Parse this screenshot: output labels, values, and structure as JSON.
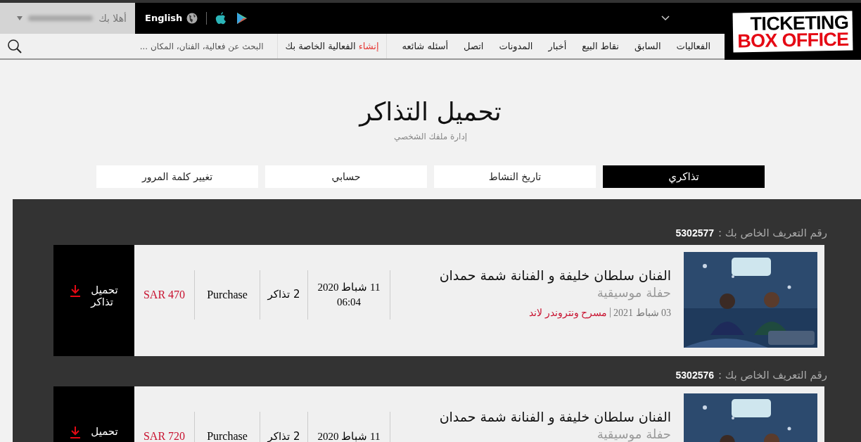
{
  "header": {
    "language": "English",
    "greeting": "أهلا بك"
  },
  "nav": [
    "الفعاليات",
    "السابق",
    "نقاط البيع",
    "أخبار",
    "المدونات",
    "اتصل",
    "أسئله شائعه"
  ],
  "create_event": {
    "highlight": "إنشاء",
    "rest": "الفعالية الخاصة بك"
  },
  "search": {
    "placeholder": "البحث عن فعالية، الفنان، المكان ..."
  },
  "logo": {
    "line1": "TICKETING",
    "line2": "BOX OFFICE"
  },
  "page": {
    "title": "تحميل التذاكر",
    "subtitle": "إدارة ملفك الشخصي"
  },
  "tabs": [
    {
      "label": "تذاكري",
      "selected": true
    },
    {
      "label": "تاريخ النشاط",
      "selected": false
    },
    {
      "label": "حسابي",
      "selected": false
    },
    {
      "label": "تغيير كلمة المرور",
      "selected": false
    }
  ],
  "bookings": [
    {
      "id_label": "رقم التعريف الخاص بك :",
      "id": "5302577",
      "title": "الفنان سلطان خليفة و الفنانة شمة حمدان",
      "category": "حفلة موسيقية",
      "event_date": "03 شباط 2021",
      "venue": "مسرح ونتروندر لاند",
      "purchase_date": [
        "11 شباط 2020",
        "06:04"
      ],
      "tickets": "2 تذاكر",
      "type": "Purchase",
      "price": "SAR 470",
      "download": [
        "تحميل",
        "تذاكر"
      ]
    },
    {
      "id_label": "رقم التعريف الخاص بك :",
      "id": "5302576",
      "title": "الفنان سلطان خليفة و الفنانة شمة حمدان",
      "category": "حفلة موسيقية",
      "purchase_date": [
        "11 شباط 2020"
      ],
      "tickets": "2 تذاكر",
      "type": "Purchase",
      "price": "SAR 720",
      "download": [
        "تحميل"
      ]
    }
  ]
}
